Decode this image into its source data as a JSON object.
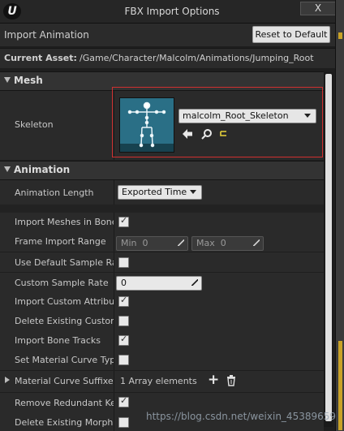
{
  "window": {
    "title": "FBX Import Options",
    "close_label": "X",
    "logo_glyph": "U"
  },
  "header": {
    "import_label": "Import Animation",
    "reset_label": "Reset to Default",
    "asset_label": "Current Asset:",
    "asset_path": "/Game/Character/Malcolm/Animations/Jumping_Root"
  },
  "mesh": {
    "category": "Mesh",
    "skeleton_label": "Skeleton",
    "skeleton_value": "malcolm_Root_Skeleton"
  },
  "animation": {
    "category": "Animation",
    "rows": {
      "length_label": "Animation Length",
      "length_value": "Exported Time",
      "bone_hierarchy_label": "Import Meshes in Bone Hierarchy",
      "frame_range_label": "Frame Import Range",
      "min_label": "Min",
      "min_value": "0",
      "max_label": "Max",
      "max_value": "0",
      "default_rate_label": "Use Default Sample Rate",
      "custom_rate_label": "Custom Sample Rate",
      "custom_rate_value": "0",
      "custom_attr_label": "Import Custom Attribute",
      "delete_custom_label": "Delete Existing Custom Attribute Curves",
      "bone_tracks_label": "Import Bone Tracks",
      "material_curve_label": "Set Material Curve Type",
      "suffixes_label": "Material Curve Suffixes",
      "suffixes_value": "1 Array elements",
      "remove_keys_label": "Remove Redundant Keys",
      "delete_morph_label": "Delete Existing Morph Target Curves"
    }
  },
  "checks": {
    "bone_hierarchy": true,
    "default_rate": false,
    "custom_attr": true,
    "delete_custom": false,
    "bone_tracks": true,
    "material_curve": false,
    "remove_keys": true,
    "delete_morph": false
  },
  "watermark": "https://blog.csdn.net/weixin_45389659",
  "colors": {
    "panel": "#2a2a2a",
    "highlight": "#d03030",
    "thumbnail": "#2a6f86"
  }
}
